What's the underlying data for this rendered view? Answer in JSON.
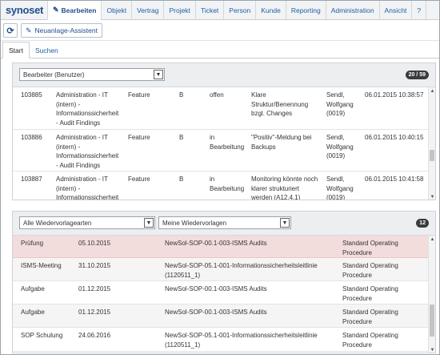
{
  "app": {
    "logo": "synoset"
  },
  "menu": [
    {
      "label": "Bearbeiten",
      "active": true,
      "icon": "edit-icon"
    },
    {
      "label": "Objekt"
    },
    {
      "label": "Vertrag"
    },
    {
      "label": "Projekt"
    },
    {
      "label": "Ticket"
    },
    {
      "label": "Person"
    },
    {
      "label": "Kunde"
    },
    {
      "label": "Reporting"
    },
    {
      "label": "Administration"
    },
    {
      "label": "Ansicht"
    },
    {
      "label": "?"
    }
  ],
  "toolbar": {
    "refresh_icon": "refresh-icon",
    "wizard_label": "Neuanlage-Assistent"
  },
  "tabs": [
    {
      "label": "Start",
      "active": true
    },
    {
      "label": "Suchen"
    }
  ],
  "tasks_panel": {
    "filter_value": "Bearbeiter (Benutzer)",
    "count": "20 / 59",
    "rows": [
      {
        "id": "103885",
        "category": [
          "Administration - IT",
          "(intern) -",
          "Informationssicherheit",
          "- Audit Findings"
        ],
        "type": "Feature",
        "priority": "B",
        "status": [
          "offen"
        ],
        "title": [
          "Klare",
          "Struktur/Benennung",
          "bzgl. Changes"
        ],
        "owner": [
          "Sendl,",
          "Wolfgang",
          "(0019)"
        ],
        "date": "06.01.2015 10:38:57"
      },
      {
        "id": "103886",
        "category": [
          "Administration - IT",
          "(intern) -",
          "Informationssicherheit",
          "- Audit Findings"
        ],
        "type": "Feature",
        "priority": "B",
        "status": [
          "in",
          "Bearbeitung"
        ],
        "title": [
          "\"Positiv\"-Meldung bei",
          "Backups"
        ],
        "owner": [
          "Sendl,",
          "Wolfgang",
          "(0019)"
        ],
        "date": "06.01.2015 10:40:15"
      },
      {
        "id": "103887",
        "category": [
          "Administration - IT",
          "(intern) -",
          "Informationssicherheit"
        ],
        "type": "Feature",
        "priority": "B",
        "status": [
          "in",
          "Bearbeitung"
        ],
        "title": [
          "Monitoring könnte noch",
          "klarer strukturiert",
          "werden (A12.4.1)"
        ],
        "owner": [
          "Sendl,",
          "Wolfgang",
          "(0019)"
        ],
        "date": "06.01.2015 10:41:58"
      }
    ]
  },
  "followup_panel": {
    "filter_type": "Alle Wiedervorlagearten",
    "filter_scope": "Meine Wiedervorlagen",
    "count": "12",
    "rows": [
      {
        "kind": "Prüfung",
        "date": "05.10.2015",
        "subject": [
          "NewSol-SOP-00.1-003-ISMS Audits"
        ],
        "doc_type": [
          "Standard Operating",
          "Procedure"
        ],
        "highlight": true
      },
      {
        "kind": "ISMS-Meeting",
        "date": "31.10.2015",
        "subject": [
          "NewSol-SOP-05.1-001-Informationssicherheitsleitlinie",
          "(1120511_1)"
        ],
        "doc_type": [
          "Standard Operating",
          "Procedure"
        ]
      },
      {
        "kind": "Aufgabe",
        "date": "01.12.2015",
        "subject": [
          "NewSol-SOP-00.1-003-ISMS Audits"
        ],
        "doc_type": [
          "Standard Operating",
          "Procedure"
        ]
      },
      {
        "kind": "Aufgabe",
        "date": "01.12.2015",
        "subject": [
          "NewSol-SOP-00.1-003-ISMS Audits"
        ],
        "doc_type": [
          "Standard Operating",
          "Procedure"
        ]
      },
      {
        "kind": "SOP Schulung",
        "date": "24.06.2016",
        "subject": [
          "NewSol-SOP-05.1-001-Informationssicherheitsleitlinie",
          "(1120511_1)"
        ],
        "doc_type": [
          "Standard Operating",
          "Procedure"
        ]
      }
    ]
  },
  "colors": {
    "link": "#1f5fa3",
    "highlight_row": "#f3dcdc",
    "badge": "#3b3b3b"
  }
}
